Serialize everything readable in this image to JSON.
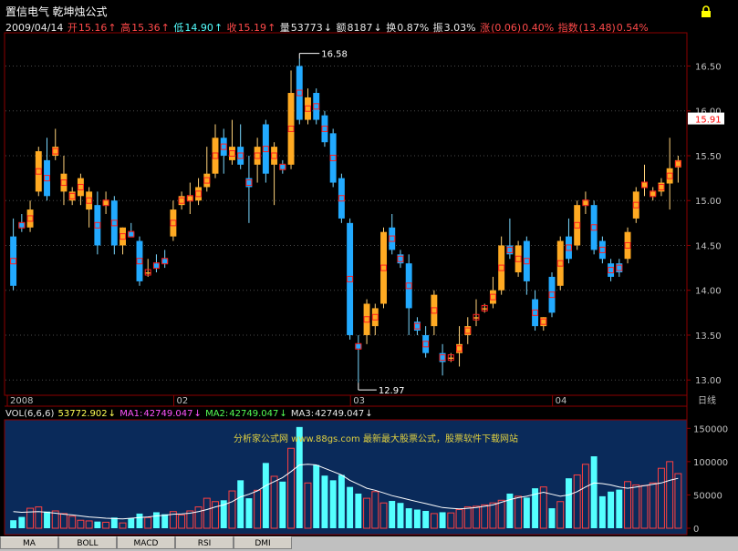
{
  "header": {
    "stock_name": "置信电气",
    "formula_name": "乾坤烛公式",
    "date": "2009/04/14",
    "open_label": "开",
    "open": "15.16",
    "high_label": "高",
    "high": "15.36",
    "low_label": "低",
    "low": "14.90",
    "close_label": "收",
    "close": "15.19",
    "vol_label": "量",
    "vol": "53773",
    "amt_label": "额",
    "amt": "8187",
    "turnover_label": "换",
    "turnover": "0.87%",
    "amplitude_label": "振",
    "amplitude": "3.03%",
    "change_label": "涨",
    "change": "(0.06)",
    "change_pct": "0.40%",
    "index_label": "指数",
    "index": "(13.48)",
    "index_pct": "0.54%"
  },
  "volume_header": {
    "label": "VOL(6,6,6)",
    "value": "53772.902",
    "ma1_label": "MA1:",
    "ma1": "42749.047",
    "ma2_label": "MA2:",
    "ma2": "42749.047",
    "ma3_label": "MA3:",
    "ma3": "42749.047"
  },
  "watermark": "分析家公式网 www.88gs.com 最新最大股票公式，股票软件下载网站",
  "tabs": [
    "MA",
    "BOLL",
    "MACD",
    "RSI",
    "DMI"
  ],
  "colors": {
    "up": "#ffaa22",
    "down": "#22aaff",
    "bg": "#000000",
    "axis": "#8b0000",
    "grid": "#4a4a4a",
    "ma": "#ffffff"
  },
  "icons": {
    "lock": "lock-icon"
  },
  "chart_data": [
    {
      "type": "candlestick",
      "y_ticks": [
        "16.50",
        "16.00",
        "15.50",
        "15.00",
        "14.50",
        "14.00",
        "13.50",
        "13.00"
      ],
      "ylim": [
        12.85,
        16.85
      ],
      "x_labels": [
        "2008",
        "02",
        "03",
        "04",
        "日线"
      ],
      "current_price_label": "15.91",
      "max_label": "16.58",
      "min_label": "12.97",
      "grid": true,
      "candles": [
        [
          14.6,
          14.05,
          14.8,
          14.0
        ],
        [
          14.75,
          14.7,
          14.85,
          14.65
        ],
        [
          14.7,
          14.9,
          15.0,
          14.65
        ],
        [
          15.1,
          15.55,
          15.6,
          15.05
        ],
        [
          15.45,
          15.05,
          15.7,
          15.0
        ],
        [
          15.5,
          15.6,
          15.8,
          15.45
        ],
        [
          15.1,
          15.3,
          15.5,
          14.95
        ],
        [
          15.0,
          15.1,
          15.15,
          14.95
        ],
        [
          15.05,
          15.25,
          15.3,
          14.95
        ],
        [
          14.9,
          15.1,
          15.15,
          14.7
        ],
        [
          14.95,
          14.5,
          15.1,
          14.4
        ],
        [
          14.95,
          15.0,
          15.1,
          14.85
        ],
        [
          15.0,
          14.5,
          15.05,
          14.4
        ],
        [
          14.5,
          14.7,
          14.7,
          14.4
        ],
        [
          14.65,
          14.6,
          14.75,
          14.6
        ],
        [
          14.55,
          14.1,
          14.6,
          14.05
        ],
        [
          14.2,
          14.2,
          14.35,
          14.15
        ],
        [
          14.3,
          14.25,
          14.4,
          14.2
        ],
        [
          14.35,
          14.3,
          14.45,
          14.25
        ],
        [
          14.6,
          14.9,
          15.0,
          14.55
        ],
        [
          14.95,
          15.05,
          15.1,
          14.9
        ],
        [
          15.0,
          15.05,
          15.2,
          14.85
        ],
        [
          15.0,
          15.15,
          15.25,
          14.95
        ],
        [
          15.15,
          15.3,
          15.6,
          15.1
        ],
        [
          15.3,
          15.7,
          15.85,
          15.25
        ],
        [
          15.7,
          15.5,
          15.8,
          15.3
        ],
        [
          15.45,
          15.6,
          15.9,
          15.4
        ],
        [
          15.6,
          15.4,
          15.85,
          15.35
        ],
        [
          15.25,
          15.15,
          15.5,
          14.75
        ],
        [
          15.4,
          15.6,
          15.7,
          15.2
        ],
        [
          15.85,
          15.3,
          15.9,
          15.2
        ],
        [
          15.4,
          15.6,
          15.65,
          14.95
        ],
        [
          15.4,
          15.35,
          15.45,
          15.3
        ],
        [
          15.4,
          16.2,
          16.45,
          15.35
        ],
        [
          16.5,
          15.9,
          16.58,
          15.85
        ],
        [
          15.9,
          16.15,
          16.25,
          15.85
        ],
        [
          16.2,
          15.9,
          16.25,
          15.85
        ],
        [
          15.95,
          15.65,
          16.0,
          15.6
        ],
        [
          15.75,
          15.2,
          15.8,
          15.15
        ],
        [
          15.25,
          14.8,
          15.3,
          14.75
        ],
        [
          14.75,
          13.5,
          14.8,
          13.45
        ],
        [
          13.4,
          13.35,
          13.5,
          12.97
        ],
        [
          13.5,
          13.85,
          13.9,
          13.4
        ],
        [
          13.6,
          13.8,
          13.85,
          13.5
        ],
        [
          13.85,
          14.65,
          14.7,
          13.8
        ],
        [
          14.7,
          14.45,
          14.85,
          14.4
        ],
        [
          14.4,
          14.3,
          14.45,
          14.25
        ],
        [
          14.3,
          13.8,
          14.4,
          13.5
        ],
        [
          13.65,
          13.55,
          13.7,
          13.5
        ],
        [
          13.5,
          13.3,
          13.6,
          13.25
        ],
        [
          13.6,
          13.95,
          14.0,
          13.5
        ],
        [
          13.3,
          13.2,
          13.4,
          13.05
        ],
        [
          13.25,
          13.25,
          13.3,
          13.2
        ],
        [
          13.3,
          13.4,
          13.6,
          13.15
        ],
        [
          13.5,
          13.6,
          13.7,
          13.4
        ],
        [
          13.7,
          13.7,
          13.9,
          13.6
        ],
        [
          13.8,
          13.8,
          13.85,
          13.75
        ],
        [
          13.85,
          14.0,
          14.15,
          13.8
        ],
        [
          14.0,
          14.5,
          14.6,
          13.95
        ],
        [
          14.5,
          14.4,
          14.8,
          14.35
        ],
        [
          14.2,
          14.5,
          14.55,
          14.15
        ],
        [
          14.55,
          14.1,
          14.6,
          13.95
        ],
        [
          13.9,
          13.6,
          14.0,
          13.55
        ],
        [
          13.6,
          13.7,
          13.7,
          13.55
        ],
        [
          14.15,
          13.75,
          14.2,
          13.7
        ],
        [
          14.05,
          14.55,
          14.6,
          14.0
        ],
        [
          14.6,
          14.35,
          14.8,
          14.3
        ],
        [
          14.5,
          14.95,
          15.0,
          14.45
        ],
        [
          14.95,
          15.0,
          15.1,
          14.85
        ],
        [
          14.95,
          14.45,
          15.0,
          14.4
        ],
        [
          14.55,
          14.35,
          14.6,
          14.3
        ],
        [
          14.3,
          14.15,
          14.35,
          14.1
        ],
        [
          14.3,
          14.2,
          14.35,
          14.15
        ],
        [
          14.35,
          14.65,
          14.7,
          14.3
        ],
        [
          14.8,
          15.1,
          15.15,
          14.75
        ],
        [
          15.15,
          15.2,
          15.4,
          15.05
        ],
        [
          15.05,
          15.1,
          15.15,
          15.0
        ],
        [
          15.1,
          15.2,
          15.25,
          15.05
        ],
        [
          15.19,
          15.36,
          15.7,
          14.9
        ],
        [
          15.37,
          15.45,
          15.5,
          15.2
        ]
      ],
      "volume_chart": {
        "y_ticks": [
          "150000",
          "100000",
          "50000",
          "0"
        ],
        "ylim": [
          0,
          160000
        ],
        "values": [
          12000,
          17000,
          30000,
          32000,
          25000,
          26000,
          22000,
          18000,
          12000,
          11000,
          10000,
          9000,
          16000,
          8000,
          15000,
          22000,
          16000,
          24000,
          21000,
          25000,
          20000,
          26000,
          32000,
          45000,
          40000,
          42000,
          56000,
          72000,
          45000,
          57000,
          98000,
          78000,
          70000,
          120000,
          152000,
          68000,
          95000,
          79000,
          72000,
          80000,
          62000,
          52000,
          45000,
          55000,
          38000,
          41000,
          38000,
          30000,
          28000,
          26000,
          22000,
          24000,
          23000,
          28000,
          32000,
          33000,
          35000,
          38000,
          42000,
          52000,
          48000,
          46000,
          60000,
          62000,
          30000,
          40000,
          75000,
          80000,
          96000,
          108000,
          48000,
          55000,
          58000,
          70000,
          65000,
          64000,
          68000,
          90000,
          100000,
          82000
        ],
        "ma_values": [
          25000,
          24000,
          24500,
          25000,
          24000,
          22500,
          21000,
          20000,
          18500,
          17000,
          16000,
          15000,
          14500,
          14000,
          15000,
          16000,
          17000,
          18500,
          19500,
          21000,
          21500,
          22500,
          25000,
          28000,
          32000,
          35000,
          40000,
          47000,
          51000,
          56000,
          64000,
          70000,
          76000,
          85000,
          95000,
          96000,
          95000,
          90000,
          85000,
          80000,
          72000,
          66000,
          60000,
          57000,
          53000,
          49000,
          46000,
          43000,
          40000,
          37000,
          34000,
          31000,
          30000,
          29000,
          30000,
          31000,
          33000,
          35000,
          39000,
          43000,
          46000,
          48000,
          51000,
          54000,
          51000,
          48000,
          50000,
          55000,
          62000,
          68000,
          67000,
          65000,
          62000,
          60000,
          62000,
          64000,
          66000,
          68000,
          72000,
          75000
        ]
      }
    }
  ]
}
